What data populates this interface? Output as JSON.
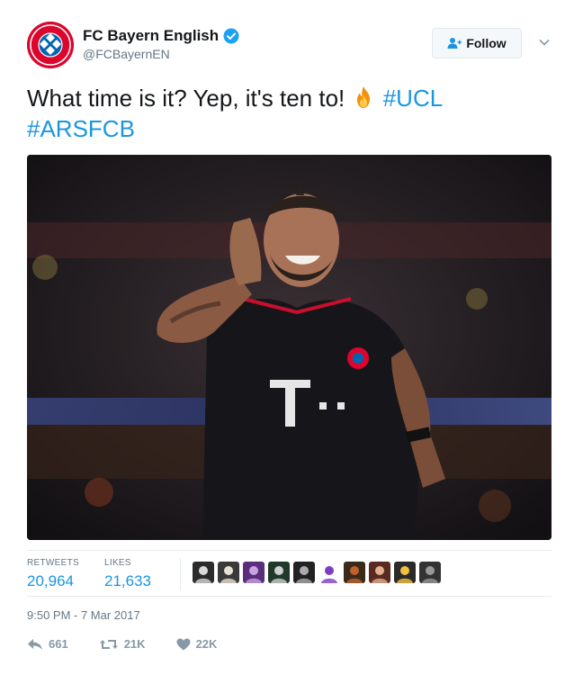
{
  "account": {
    "display_name": "FC Bayern English",
    "handle": "@FCBayernEN",
    "avatar_icon": "fc-bayern-crest",
    "verified_icon": "verified-badge-icon",
    "brand_color": "#dc052d"
  },
  "follow": {
    "label": "Follow",
    "icon": "add-user-icon"
  },
  "tweet": {
    "text": "What time is it? Yep, it's ten to!",
    "emoji": "fire",
    "hashtags": [
      "#UCL",
      "#ARSFCB"
    ],
    "link_color": "#1b95e0"
  },
  "media": {
    "description_icon": "photo"
  },
  "stats": {
    "retweets_label": "RETWEETS",
    "retweets_value": "20,964",
    "likes_label": "LIKES",
    "likes_value": "21,633",
    "liker_avatar_count": 10
  },
  "timestamp": "9:50 PM - 7 Mar 2017",
  "actions": {
    "reply_count": "661",
    "retweet_count": "21K",
    "like_count": "22K"
  }
}
